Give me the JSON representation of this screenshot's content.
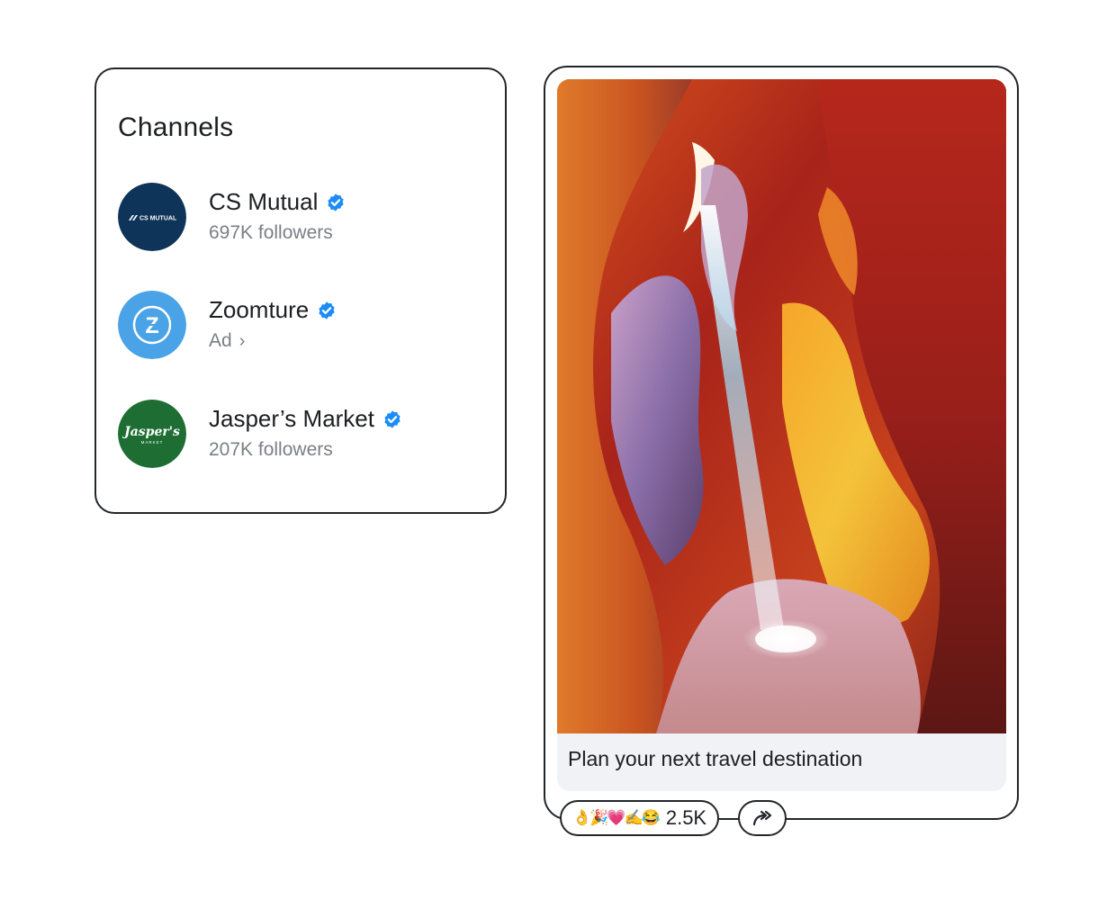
{
  "channels": {
    "title": "Channels",
    "items": [
      {
        "name": "CS Mutual",
        "subtitle": "697K followers",
        "verified": true,
        "avatar_text": "CS MUTUAL",
        "avatar_color": "#0f3459"
      },
      {
        "name": "Zoomture",
        "subtitle": "Ad",
        "subtitle_icon": "chevron-right-icon",
        "verified": true,
        "avatar_text": "Z",
        "avatar_color": "#4aa3e6"
      },
      {
        "name": "Jasper’s Market",
        "subtitle": "207K followers",
        "verified": true,
        "avatar_text": "Jasper's",
        "avatar_subtext": "MARKET",
        "avatar_color": "#1e6e34"
      }
    ]
  },
  "post": {
    "image_icon": "slot-canyon-photo",
    "caption": "Plan your next travel destination",
    "reactions": {
      "emojis": "👌🎉💗✍️😂",
      "count": "2.5K"
    },
    "share_icon": "share-arrow-icon"
  },
  "colors": {
    "verified_blue": "#1d8cf8",
    "border": "#22262b",
    "muted_text": "#7a8087",
    "caption_bg": "#f0f2f5"
  }
}
